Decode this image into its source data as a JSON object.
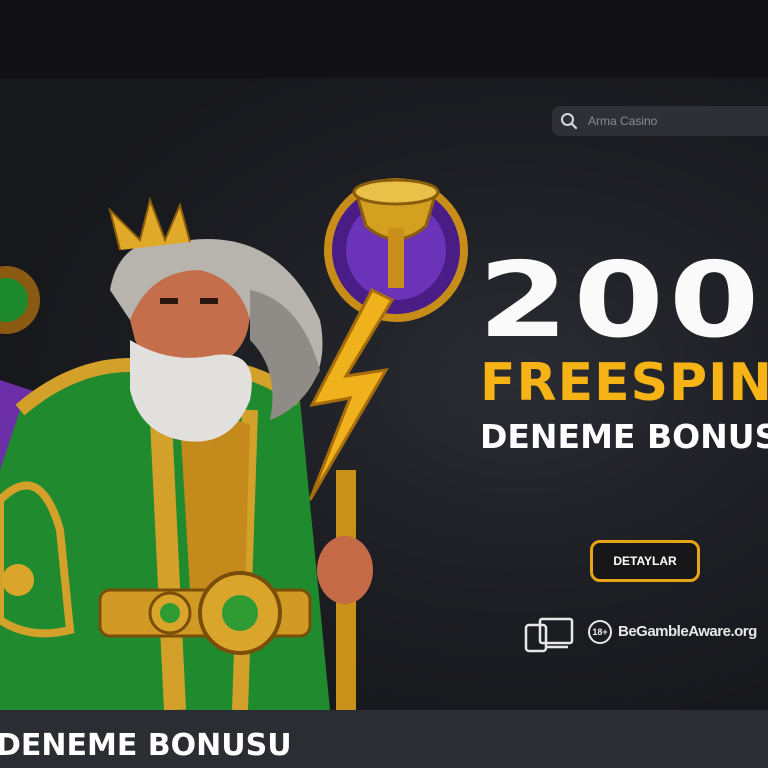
{
  "search": {
    "placeholder": "Arma Casino",
    "icon": "search-icon"
  },
  "banner": {
    "headline_amount": "200",
    "headline_freespin": "FREESPIN",
    "headline_bonus": "DENEME BONUSU",
    "cta_label": "DETAYLAR",
    "age_badge": "18+",
    "responsible_gambling": "BeGambleAware.org",
    "colors": {
      "accent": "#f5b315",
      "button_border": "#e8a414",
      "background": "#1e1f24"
    }
  },
  "section": {
    "title": "DENEME BONUSU"
  }
}
